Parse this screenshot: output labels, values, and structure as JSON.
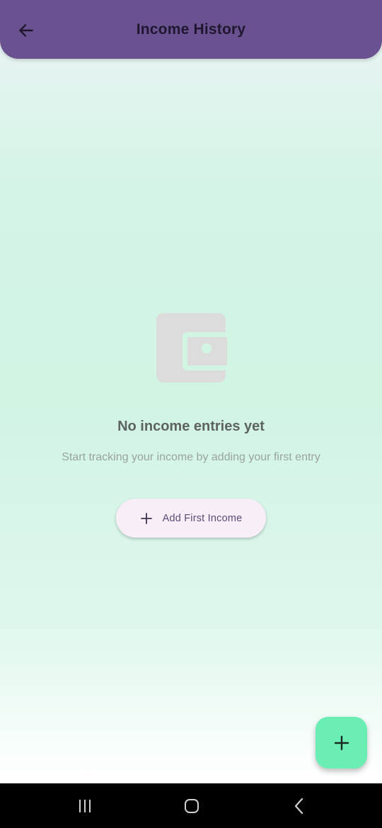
{
  "header": {
    "title": "Income History",
    "back_icon": "arrow-left-icon",
    "background_color": "#6a5291"
  },
  "empty_state": {
    "icon": "wallet-icon",
    "title": "No income entries yet",
    "subtitle": "Start tracking your income by adding your first entry",
    "button_label": "Add First Income",
    "button_icon": "plus-icon"
  },
  "fab": {
    "icon": "plus-icon",
    "color": "#6aeeb4"
  },
  "system_nav": {
    "recent_icon": "recent-apps-icon",
    "home_icon": "home-icon",
    "back_icon": "back-chevron-icon"
  }
}
